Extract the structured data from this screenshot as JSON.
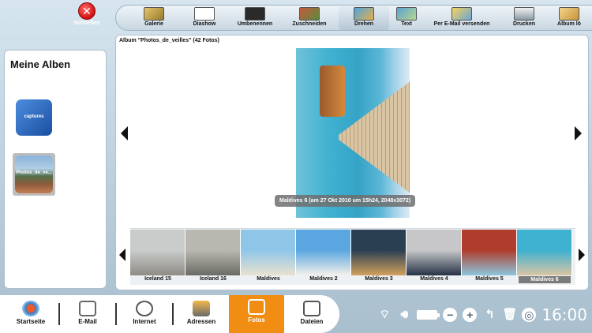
{
  "toolbar": {
    "close_label": "Schließen",
    "items": [
      {
        "label": "Galerie",
        "icon": "gallery-icon"
      },
      {
        "label": "Diashow",
        "icon": "slideshow-icon"
      },
      {
        "label": "Umbenennen",
        "icon": "rename-icon"
      },
      {
        "label": "Zuschneiden",
        "icon": "crop-icon"
      },
      {
        "label": "Drehen",
        "icon": "rotate-icon",
        "active": true
      },
      {
        "label": "Text",
        "icon": "text-icon"
      },
      {
        "label": "Per E-Mail versenden",
        "icon": "email-send-icon"
      },
      {
        "label": "Drucken",
        "icon": "print-icon"
      },
      {
        "label": "Album lö",
        "icon": "album-delete-icon"
      }
    ]
  },
  "sidebar": {
    "title": "Meine Alben",
    "albums": [
      {
        "label": "captures"
      },
      {
        "label": "Photos_de_ve..."
      }
    ]
  },
  "main": {
    "album_title": "Album \"Photos_de_veilles\" (42 Fotos)",
    "caption": "Maldives 6 (am 27 Okt 2010 um 15h24, 2048x3072)",
    "thumbnails": [
      {
        "label": "Iceland 15",
        "c1": "#c9ccca",
        "c2": "#8f8b84"
      },
      {
        "label": "Iceland 16",
        "c1": "#b8b8b0",
        "c2": "#6a6b64"
      },
      {
        "label": "Maldives",
        "c1": "#8fc6e8",
        "c2": "#e9e2d0"
      },
      {
        "label": "Maldives 2",
        "c1": "#5aa6e0",
        "c2": "#f3f1ea"
      },
      {
        "label": "Maldives 3",
        "c1": "#2b3f53",
        "c2": "#d2a15c"
      },
      {
        "label": "Maldives 4",
        "c1": "#c7c7c9",
        "c2": "#253245"
      },
      {
        "label": "Maldives 5",
        "c1": "#b03c2d",
        "c2": "#8cc6dc"
      },
      {
        "label": "Maldives 6",
        "c1": "#3fb1d1",
        "c2": "#d9c5a3",
        "selected": true
      }
    ]
  },
  "nav": [
    {
      "label": "Startseite",
      "icon": "home-icon"
    },
    {
      "label": "E-Mail",
      "icon": "mail-icon"
    },
    {
      "label": "Internet",
      "icon": "globe-icon"
    },
    {
      "label": "Adressen",
      "icon": "contacts-icon"
    },
    {
      "label": "Fotos",
      "icon": "camera-icon",
      "active": true
    },
    {
      "label": "Dateien",
      "icon": "files-icon"
    }
  ],
  "status": {
    "time": "16:00"
  }
}
